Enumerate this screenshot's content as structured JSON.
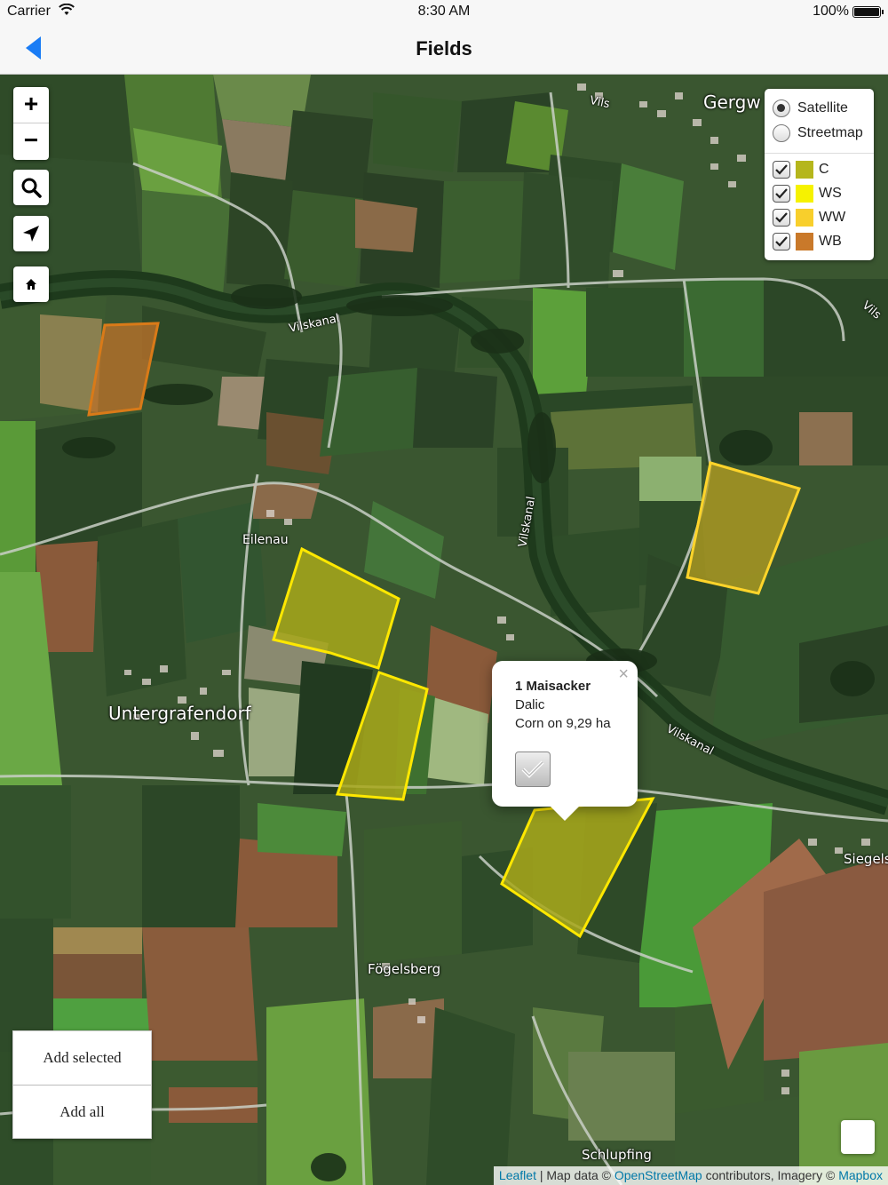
{
  "status_bar": {
    "carrier": "Carrier",
    "time": "8:30 AM",
    "battery": "100%"
  },
  "nav": {
    "title": "Fields"
  },
  "map": {
    "labels": {
      "gergw": "Gergw",
      "vils_top": "Vils",
      "vils_right": "Vils",
      "vilskanal_top": "Vilskanal",
      "vilskanal_mid": "Vilskanal",
      "vilskanal_right": "Vilskanal",
      "eilenau": "Eilenau",
      "untergrafendorf": "Untergrafendorf",
      "fogelsberg": "Fögelsberg",
      "siegels": "Siegels",
      "schlupfing": "Schlupfing"
    },
    "zoom_in": "+",
    "zoom_out": "−"
  },
  "layers": {
    "base": [
      {
        "label": "Satellite",
        "selected": true
      },
      {
        "label": "Streetmap",
        "selected": false
      }
    ],
    "overlays": [
      {
        "label": "C",
        "color": "#b5b61c",
        "checked": true
      },
      {
        "label": "WS",
        "color": "#f6f200",
        "checked": true
      },
      {
        "label": "WW",
        "color": "#f8cf2c",
        "checked": true
      },
      {
        "label": "WB",
        "color": "#c9792a",
        "checked": true
      }
    ]
  },
  "popup": {
    "close": "×",
    "name": "1 Maisacker",
    "variety": "Dalic",
    "description": "Corn on 9,29 ha"
  },
  "actions": {
    "add_selected": "Add selected",
    "add_all": "Add all"
  },
  "attribution": {
    "leaflet": "Leaflet",
    "sep": " | Map data © ",
    "osm": "OpenStreetMap",
    "mid": " contributors, Imagery © ",
    "mapbox": "Mapbox"
  },
  "colors": {
    "field_corn": "#a8a81a",
    "field_wb": "#b8702a",
    "outline_yellow": "#ffe800",
    "outline_orange": "#d97a18"
  }
}
